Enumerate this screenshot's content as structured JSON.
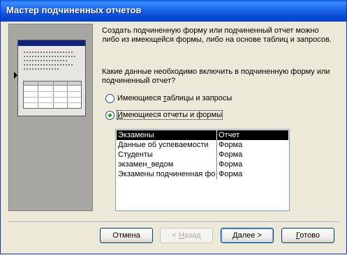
{
  "window": {
    "title": "Мастер подчиненных отчетов"
  },
  "description": "Создать подчиненную форму или подчиненный отчет можно либо из имеющейся формы, либо на основе таблиц и запросов.",
  "question": "Какие данные необходимо включить в подчиненную форму или подчиненный отчет?",
  "options": [
    {
      "pre": "Имеющиеся ",
      "key": "т",
      "post": "аблицы и запросы",
      "selected": false
    },
    {
      "pre": "",
      "key": "И",
      "post": "меющиеся отчеты и формы",
      "selected": true
    }
  ],
  "list": {
    "items": [
      {
        "name": "Экзамены",
        "type": "Отчет",
        "selected": true
      },
      {
        "name": "Данные об успеваемости",
        "type": "Форма",
        "selected": false
      },
      {
        "name": "Студенты",
        "type": "Форма",
        "selected": false
      },
      {
        "name": "экзамен_ведом",
        "type": "Форма",
        "selected": false
      },
      {
        "name": "Экзамены подчиненная форма",
        "type": "Форма",
        "selected": false
      }
    ]
  },
  "buttons": {
    "cancel": "Отмена",
    "back": {
      "pre": "< ",
      "key": "Н",
      "post": "азад"
    },
    "next": {
      "pre": "",
      "key": "Д",
      "post": "алее >"
    },
    "finish": {
      "pre": "",
      "key": "Г",
      "post": "отово"
    }
  }
}
